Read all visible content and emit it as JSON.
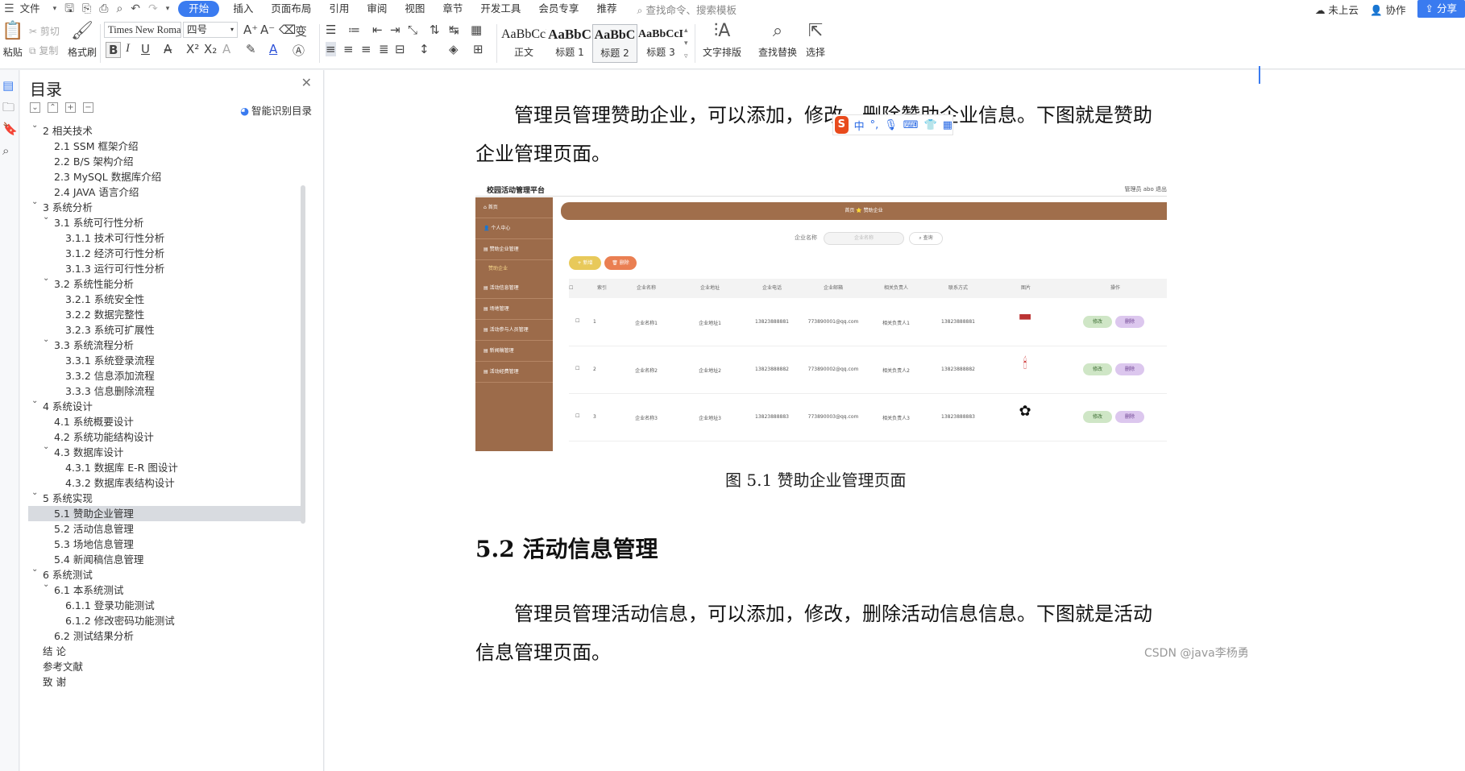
{
  "menubar": {
    "file": "文件",
    "tabs": [
      "开始",
      "插入",
      "页面布局",
      "引用",
      "审阅",
      "视图",
      "章节",
      "开发工具",
      "会员专享",
      "推荐"
    ],
    "active_tab": "开始",
    "search_placeholder": "查找命令、搜索模板",
    "cloud": "未上云",
    "collab": "协作",
    "share": "分享"
  },
  "ribbon": {
    "paste": "粘贴",
    "cut": "剪切",
    "copy": "复制",
    "format_painter": "格式刷",
    "font_name": "Times New Roma",
    "font_size": "四号",
    "styles": [
      {
        "preview": "AaBbCcI",
        "name": "正文"
      },
      {
        "preview": "AaBbC",
        "name": "标题 1"
      },
      {
        "preview": "AaBbC",
        "name": "标题 2"
      },
      {
        "preview": "AaBbCcI",
        "name": "标题 3"
      }
    ],
    "text_layout": "文字排版",
    "find_replace": "查找替换",
    "select": "选择"
  },
  "toc": {
    "title": "目录",
    "smart": "智能识别目录",
    "items": [
      {
        "text": "2 相关技术",
        "level": 0,
        "chev": true
      },
      {
        "text": "2.1 SSM 框架介绍",
        "level": 1
      },
      {
        "text": "2.2 B/S 架构介绍",
        "level": 1
      },
      {
        "text": "2.3 MySQL 数据库介绍",
        "level": 1
      },
      {
        "text": "2.4 JAVA 语言介绍",
        "level": 1
      },
      {
        "text": "3  系统分析",
        "level": 0,
        "chev": true
      },
      {
        "text": "3.1 系统可行性分析",
        "level": 1,
        "chev": true
      },
      {
        "text": "3.1.1  技术可行性分析",
        "level": 2
      },
      {
        "text": "3.1.2  经济可行性分析",
        "level": 2
      },
      {
        "text": "3.1.3  运行可行性分析",
        "level": 2
      },
      {
        "text": "3.2 系统性能分析",
        "level": 1,
        "chev": true
      },
      {
        "text": "3.2.1  系统安全性",
        "level": 2
      },
      {
        "text": "3.2.2  数据完整性",
        "level": 2
      },
      {
        "text": "3.2.3 系统可扩展性",
        "level": 2
      },
      {
        "text": "3.3 系统流程分析",
        "level": 1,
        "chev": true
      },
      {
        "text": "3.3.1 系统登录流程",
        "level": 2
      },
      {
        "text": "3.3.2 信息添加流程",
        "level": 2
      },
      {
        "text": "3.3.3 信息删除流程",
        "level": 2
      },
      {
        "text": "4  系统设计",
        "level": 0,
        "chev": true
      },
      {
        "text": "4.1 系统概要设计",
        "level": 1
      },
      {
        "text": "4.2 系统功能结构设计",
        "level": 1
      },
      {
        "text": "4.3 数据库设计",
        "level": 1,
        "chev": true
      },
      {
        "text": "4.3.1 数据库 E-R 图设计",
        "level": 2
      },
      {
        "text": "4.3.2  数据库表结构设计",
        "level": 2
      },
      {
        "text": "5  系统实现",
        "level": 0,
        "chev": true
      },
      {
        "text": "5.1 赞助企业管理",
        "level": 1,
        "selected": true
      },
      {
        "text": "5.2  活动信息管理",
        "level": 1
      },
      {
        "text": "5.3  场地信息管理",
        "level": 1
      },
      {
        "text": "5.4 新闻稿信息管理",
        "level": 1
      },
      {
        "text": "6 系统测试",
        "level": 0,
        "chev": true
      },
      {
        "text": "6.1  本系统测试",
        "level": 1,
        "chev": true
      },
      {
        "text": "6.1.1 登录功能测试",
        "level": 2
      },
      {
        "text": "6.1.2 修改密码功能测试",
        "level": 2
      },
      {
        "text": "6.2 测试结果分析",
        "level": 1
      },
      {
        "text": "结   论",
        "level": 0
      },
      {
        "text": "参考文献",
        "level": 0
      },
      {
        "text": "致   谢",
        "level": 0
      }
    ]
  },
  "doc": {
    "para1_line1": "管理员管理赞助企业，可以添加，修改，删除赞助企业信息。下图就是赞助",
    "para1_line2": "企业管理页面。",
    "caption": "图 5.1  赞助企业管理页面",
    "heading": "5.2  活动信息管理",
    "para2_line1": "管理员管理活动信息，可以添加，修改，删除活动信息信息。下图就是活动",
    "para2_line2": "信息管理页面。"
  },
  "ime": {
    "label": "中"
  },
  "shot": {
    "title": "校园活动管理平台",
    "user": "管理员 abo    退出",
    "menu": [
      "首页",
      "个人中心",
      "赞助企业管理",
      "活动信息管理",
      "场地管理",
      "活动参与人员管理",
      "新闻稿管理",
      "活动经费管理"
    ],
    "submenu": "赞助企业",
    "breadcrumb": "首页 ⭐ 赞助企业",
    "search_label": "企业名称",
    "search_placeholder": "企业名称",
    "search_btn": "查询",
    "add_btn": "新增",
    "del_btn": "删除",
    "headers": [
      "索引",
      "企业名称",
      "企业地址",
      "企业电话",
      "企业邮箱",
      "相关负责人",
      "联系方式",
      "图片",
      "操作"
    ],
    "rows": [
      [
        "1",
        "企业名称1",
        "企业地址1",
        "13823888881",
        "773890001@qq.com",
        "相关负责人1",
        "13823888881"
      ],
      [
        "2",
        "企业名称2",
        "企业地址2",
        "13823888882",
        "773890002@qq.com",
        "相关负责人2",
        "13823888882"
      ],
      [
        "3",
        "企业名称3",
        "企业地址3",
        "13823888883",
        "773890003@qq.com",
        "相关负责人3",
        "13823888883"
      ]
    ],
    "edit": "修改",
    "remove": "删除"
  },
  "watermark": "CSDN @java李杨勇"
}
